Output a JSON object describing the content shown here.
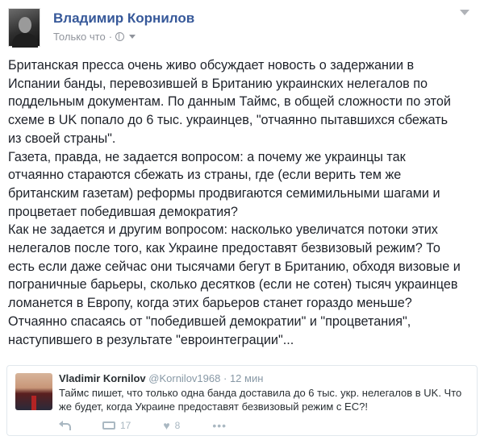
{
  "fb_post": {
    "author": "Владимир Корнилов",
    "timestamp": "Только что",
    "separator": "·",
    "lines": [
      "Британская пресса очень живо обсуждает новость о задержании в",
      "Испании банды, перевозившей в Британию украинских нелегалов по",
      "поддельным документам. По данным Таймс, в общей сложности по этой",
      "схеме в UK попало до 6 тыс. украинцев, \"отчаянно пытавшихся сбежать",
      "из своей страны\".",
      "Газета, правда, не задается вопросом: а почему же украинцы так",
      "отчаянно стараются сбежать из страны, где (если верить тем же",
      "британским газетам) реформы продвигаются семимильными шагами и",
      "процветает победившая демократия?",
      "Как не задается и другим вопросом: насколько увеличатся потоки этих",
      "нелегалов после того, как Украине предоставят безвизовый режим? То",
      "есть если даже сейчас они тысячами бегут в Британию, обходя визовые и",
      "пограничные барьеры, сколько десятков (если не сотен) тысяч украинцев",
      "ломанется в Европу, когда этих барьеров станет гораздо меньше?",
      "Отчаянно спасаясь от \"победившей демократии\" и \"процветания\",",
      "наступившего в результате \"евроинтеграции\"..."
    ]
  },
  "tweet": {
    "name": "Vladimir Kornilov",
    "handle": "@Kornilov1968",
    "separator": "·",
    "time": "12 мин",
    "text": "Таймс пишет, что только одна банда доставила до 6 тыс. укр. нелегалов в UK. Что же будет, когда Украине предоставят безвизовый режим с ЕС?!",
    "retweets": "17",
    "likes": "8",
    "more": "•••"
  },
  "icons": {
    "globe": "globe-icon",
    "caret": "caret-down-icon",
    "reply": "reply-icon",
    "retweet": "retweet-icon",
    "like": "heart-icon",
    "more": "more-icon"
  }
}
